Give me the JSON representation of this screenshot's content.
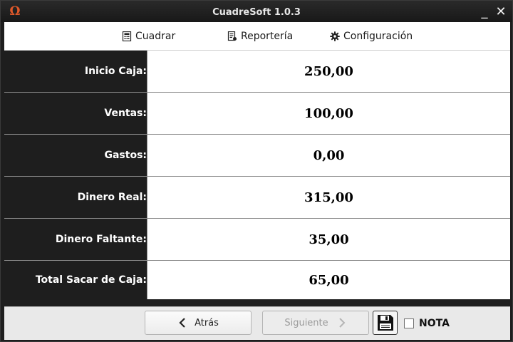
{
  "window": {
    "title": "CuadreSoft 1.0.3",
    "minimize_label": "_",
    "close_label": "✕",
    "app_icon_glyph": "Ω"
  },
  "menu": {
    "items": [
      {
        "label": "Cuadrar",
        "icon": "calculator-icon"
      },
      {
        "label": "Reportería",
        "icon": "report-icon"
      },
      {
        "label": "Configuración",
        "icon": "gear-icon"
      }
    ]
  },
  "summary": {
    "rows": [
      {
        "label": "Inicio Caja:",
        "value": "250,00"
      },
      {
        "label": "Ventas:",
        "value": "100,00"
      },
      {
        "label": "Gastos:",
        "value": "0,00"
      },
      {
        "label": "Dinero Real:",
        "value": "315,00"
      },
      {
        "label": "Dinero Faltante:",
        "value": "35,00"
      },
      {
        "label": "Total Sacar de Caja:",
        "value": "65,00"
      }
    ]
  },
  "footer": {
    "back_label": "Atrás",
    "next_label": "Siguiente",
    "save_icon": "floppy-disk-icon",
    "nota_label": "NOTA",
    "nota_checked": false
  },
  "colors": {
    "label_bg": "#1e1e1e",
    "value_bg": "#ffffff",
    "app_icon": "#e0592a"
  }
}
